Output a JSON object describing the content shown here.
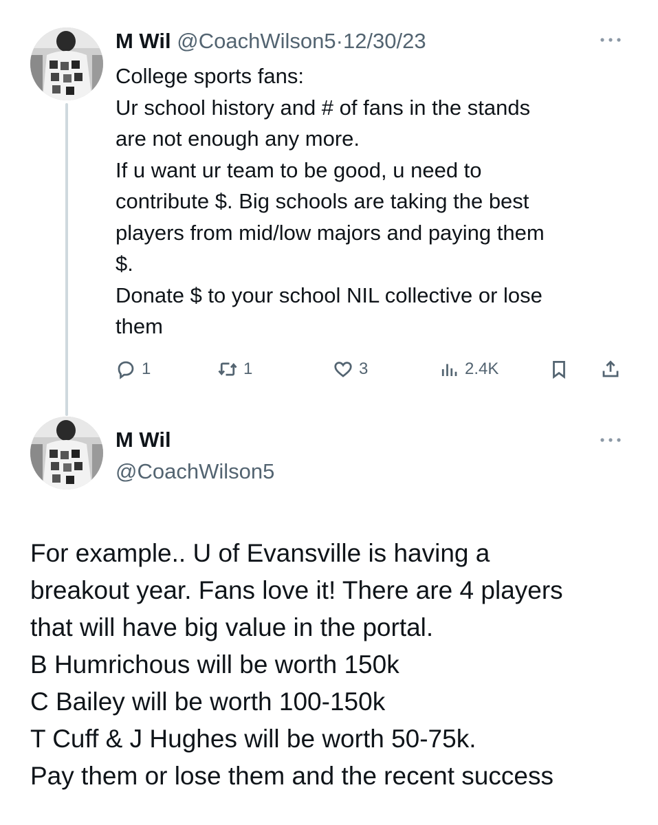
{
  "tweet1": {
    "name": "M Wil",
    "handle": "@CoachWilson5",
    "separator": "·",
    "date": "12/30/23",
    "lines": [
      "College sports fans:",
      "Ur school history and # of fans in the stands",
      "are not enough any more.",
      "If u want ur team to be good, u need to",
      "contribute $. Big schools are taking the best",
      "players from mid/low majors and paying them",
      "$.",
      "Donate $ to your school NIL collective or lose",
      "them"
    ],
    "replies": "1",
    "reposts": "1",
    "likes": "3",
    "views": "2.4K"
  },
  "tweet2": {
    "name": "M Wil",
    "handle": "@CoachWilson5",
    "lines": [
      "For example.. U of Evansville is having a",
      "breakout year. Fans love it! There are 4 players",
      "that will have big value in the portal.",
      "B Humrichous will be worth 150k",
      "C Bailey will be worth 100-150k",
      "T Cuff & J Hughes will be worth 50-75k.",
      "Pay them or lose them and the recent success"
    ]
  },
  "icons": {
    "reply": "reply-icon",
    "repost": "repost-icon",
    "like": "heart-icon",
    "views": "views-icon",
    "bookmark": "bookmark-icon",
    "share": "share-icon",
    "more": "more-icon"
  },
  "colors": {
    "text": "#0f1419",
    "muted": "#536471",
    "thread_line": "#cfd9de"
  }
}
